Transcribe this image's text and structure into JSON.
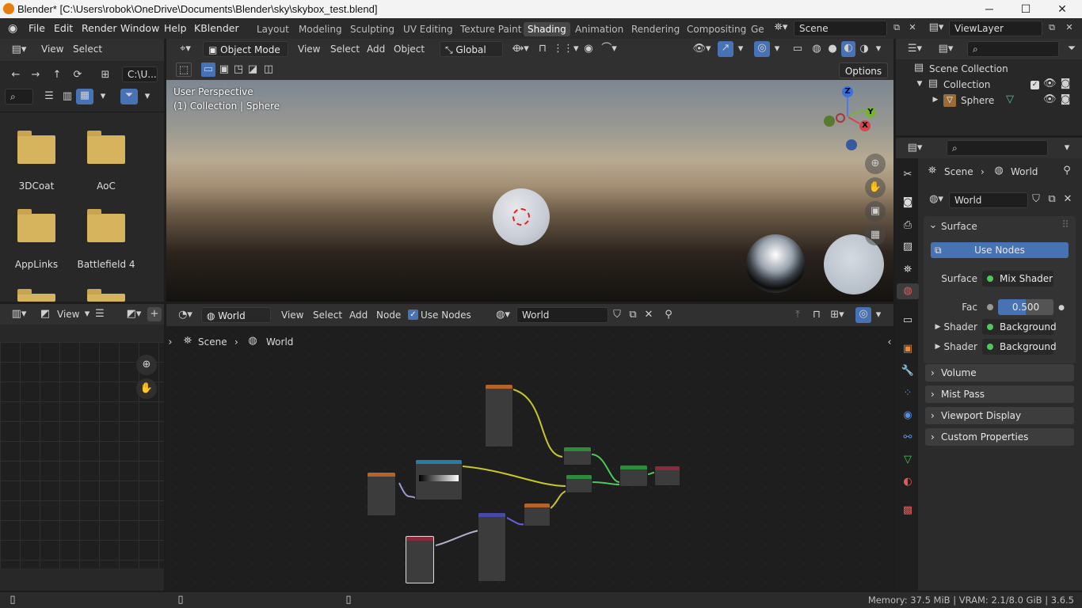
{
  "window": {
    "title": "Blender* [C:\\Users\\robok\\OneDrive\\Documents\\Blender\\sky\\skybox_test.blend]",
    "min": "─",
    "max": "☐",
    "close": "✕"
  },
  "menubar": [
    "File",
    "Edit",
    "Render",
    "Window",
    "Help",
    "KBlender"
  ],
  "workspaces": [
    "Layout",
    "Modeling",
    "Sculpting",
    "UV Editing",
    "Texture Paint",
    "Shading",
    "Animation",
    "Rendering",
    "Compositing",
    "Ge"
  ],
  "active_workspace": "Shading",
  "scene": {
    "name": "Scene"
  },
  "viewlayer": {
    "name": "ViewLayer"
  },
  "filebrowser": {
    "menus": [
      "View",
      "Select"
    ],
    "path": "C:\\U...",
    "folders": [
      "3DCoat",
      "AoC",
      "AppLinks",
      "Battlefield 4"
    ]
  },
  "viewport": {
    "mode": "Object Mode",
    "menus": [
      "View",
      "Select",
      "Add",
      "Object"
    ],
    "orientation": "Global",
    "options_label": "Options",
    "overlay_line1": "User Perspective",
    "overlay_line2": "(1) Collection | Sphere",
    "gizmo": {
      "z": "Z",
      "y": "Y",
      "x": "X"
    }
  },
  "image_editor": {
    "view_label": "View"
  },
  "node_editor": {
    "type": "World",
    "menus": [
      "View",
      "Select",
      "Add",
      "Node"
    ],
    "use_nodes_label": "Use Nodes",
    "world_name": "World",
    "breadcrumb": [
      "Scene",
      "World"
    ]
  },
  "outliner": {
    "items": [
      {
        "label": "Scene Collection"
      },
      {
        "label": "Collection"
      },
      {
        "label": "Sphere"
      }
    ]
  },
  "properties": {
    "breadcrumb": [
      "Scene",
      "World"
    ],
    "world_name": "World",
    "surface_section": "Surface",
    "use_nodes_button": "Use Nodes",
    "surface_label": "Surface",
    "surface_value": "Mix Shader",
    "fac_label": "Fac",
    "fac_value": "0.500",
    "fac_fill": 0.5,
    "shader1_label": "Shader",
    "shader1_value": "Background",
    "shader2_label": "Shader",
    "shader2_value": "Background",
    "sections": [
      "Volume",
      "Mist Pass",
      "Viewport Display",
      "Custom Properties"
    ]
  },
  "status": {
    "text": "Memory: 37.5 MiB | VRAM: 2.1/8.0 GiB | 3.6.5"
  },
  "colors": {
    "accent": "#4772b3",
    "header": "#303030",
    "bg": "#1d1d1d"
  }
}
